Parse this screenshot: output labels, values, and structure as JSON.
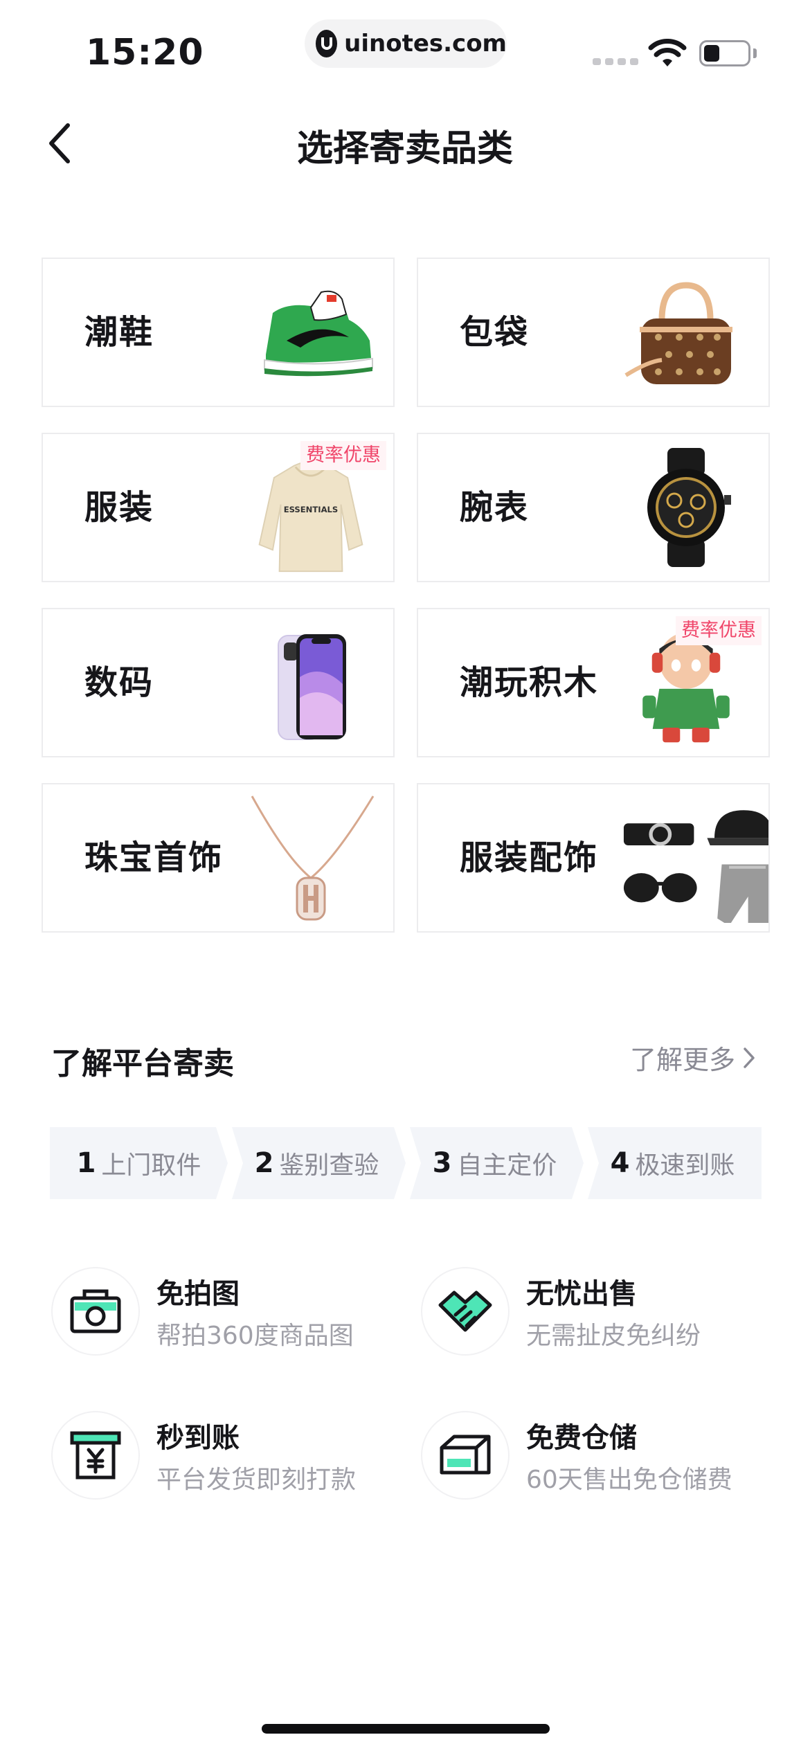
{
  "status_bar": {
    "time": "15:20",
    "url": "uinotes.com",
    "icons": [
      "signal-icon",
      "wifi-icon",
      "battery-icon"
    ]
  },
  "nav": {
    "back_icon": "chevron-left-icon",
    "title": "选择寄卖品类"
  },
  "categories": [
    {
      "label": "潮鞋",
      "image": "sneaker",
      "tag": ""
    },
    {
      "label": "包袋",
      "image": "handbag",
      "tag": ""
    },
    {
      "label": "服装",
      "image": "hoodie",
      "tag": "费率优惠"
    },
    {
      "label": "腕表",
      "image": "watch",
      "tag": ""
    },
    {
      "label": "数码",
      "image": "phone",
      "tag": ""
    },
    {
      "label": "潮玩积木",
      "image": "figure-toy",
      "tag": "费率优惠"
    },
    {
      "label": "珠宝首饰",
      "image": "necklace",
      "tag": ""
    },
    {
      "label": "服装配饰",
      "image": "accessories",
      "tag": ""
    }
  ],
  "learn": {
    "title": "了解平台寄卖",
    "more_label": "了解更多",
    "more_icon": "chevron-right-icon"
  },
  "steps": [
    {
      "num": "1",
      "label": "上门取件"
    },
    {
      "num": "2",
      "label": "鉴别查验"
    },
    {
      "num": "3",
      "label": "自主定价"
    },
    {
      "num": "4",
      "label": "极速到账"
    }
  ],
  "features": [
    {
      "title": "免拍图",
      "desc": "帮拍360度商品图",
      "icon": "camera-icon"
    },
    {
      "title": "无忧出售",
      "desc": "无需扯皮免纠纷",
      "icon": "handshake-icon"
    },
    {
      "title": "秒到账",
      "desc": "平台发货即刻打款",
      "icon": "yuan-box-icon"
    },
    {
      "title": "免费仓储",
      "desc": "60天售出免仓储费",
      "icon": "warehouse-box-icon"
    }
  ],
  "colors": {
    "accent": "#01c2c3",
    "icon_green": "#4ee5b6",
    "promo": "#f0466a",
    "text": "#16161a",
    "muted": "#8a8a94"
  }
}
